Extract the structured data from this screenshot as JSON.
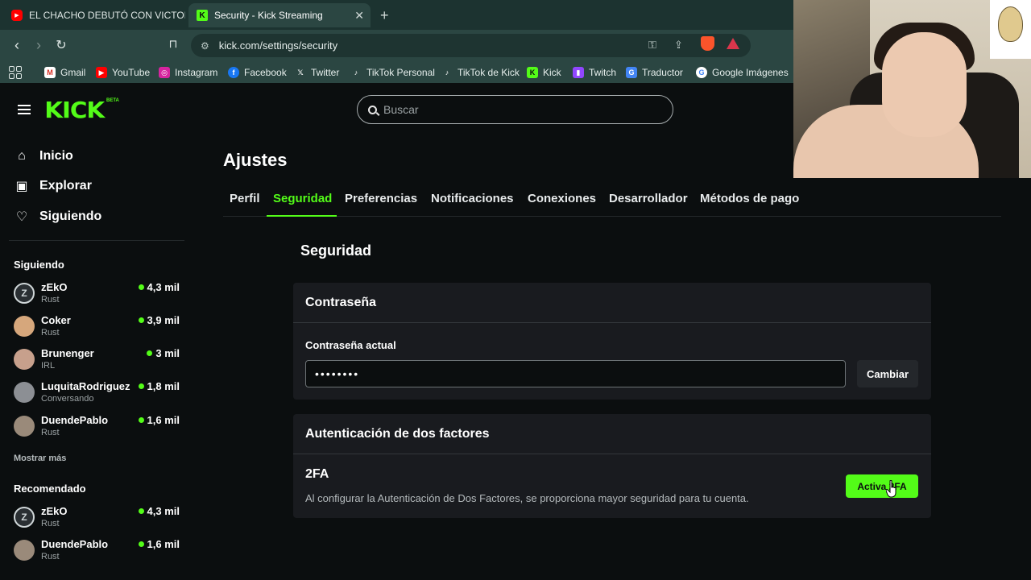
{
  "browser": {
    "tabs": [
      {
        "title": "EL CHACHO DEBUTÓ CON VICTORIA",
        "favicon": "youtube-icon"
      },
      {
        "title": "Security - Kick Streaming",
        "favicon": "kick-icon",
        "active": true
      }
    ],
    "url": "kick.com/settings/security",
    "bookmarks": [
      {
        "label": "Gmail",
        "icon": "gmail-icon"
      },
      {
        "label": "YouTube",
        "icon": "youtube-icon"
      },
      {
        "label": "Instagram",
        "icon": "instagram-icon"
      },
      {
        "label": "Facebook",
        "icon": "facebook-icon"
      },
      {
        "label": "Twitter",
        "icon": "x-icon"
      },
      {
        "label": "TikTok Personal",
        "icon": "tiktok-icon"
      },
      {
        "label": "TikTok de Kick",
        "icon": "tiktok-icon"
      },
      {
        "label": "Kick",
        "icon": "kick-icon"
      },
      {
        "label": "Twitch",
        "icon": "twitch-icon"
      },
      {
        "label": "Traductor",
        "icon": "translate-icon"
      },
      {
        "label": "Google Imágenes",
        "icon": "google-icon"
      }
    ]
  },
  "header": {
    "logo": "KICK",
    "beta": "BETA",
    "search_placeholder": "Buscar"
  },
  "sidebar": {
    "nav": [
      {
        "label": "Inicio",
        "icon": "home-icon"
      },
      {
        "label": "Explorar",
        "icon": "browse-icon"
      },
      {
        "label": "Siguiendo",
        "icon": "heart-icon"
      }
    ],
    "following_title": "Siguiendo",
    "following": [
      {
        "name": "zEkO",
        "category": "Rust",
        "viewers": "4,3 mil"
      },
      {
        "name": "Coker",
        "category": "Rust",
        "viewers": "3,9 mil"
      },
      {
        "name": "Brunenger",
        "category": "IRL",
        "viewers": "3 mil"
      },
      {
        "name": "LuquitaRodriguez",
        "category": "Conversando",
        "viewers": "1,8 mil"
      },
      {
        "name": "DuendePablo",
        "category": "Rust",
        "viewers": "1,6 mil"
      }
    ],
    "show_more": "Mostrar más",
    "recommended_title": "Recomendado",
    "recommended": [
      {
        "name": "zEkO",
        "category": "Rust",
        "viewers": "4,3 mil"
      },
      {
        "name": "DuendePablo",
        "category": "Rust",
        "viewers": "1,6 mil"
      }
    ]
  },
  "settings": {
    "title": "Ajustes",
    "tabs": [
      "Perfil",
      "Seguridad",
      "Preferencias",
      "Notificaciones",
      "Conexiones",
      "Desarrollador",
      "Métodos de pago"
    ],
    "active_tab": "Seguridad",
    "section_title": "Seguridad",
    "password_card": {
      "title": "Contraseña",
      "label": "Contraseña actual",
      "value": "••••••••",
      "button": "Cambiar"
    },
    "twofa_card": {
      "title": "Autenticación de dos factores",
      "subtitle": "2FA",
      "description": "Al configurar la Autenticación de Dos Factores, se proporciona mayor seguridad para tu cuenta.",
      "button": "Activa 2FA"
    }
  },
  "colors": {
    "accent": "#53fc18",
    "background": "#0b0e0f",
    "card": "#191b1f"
  }
}
